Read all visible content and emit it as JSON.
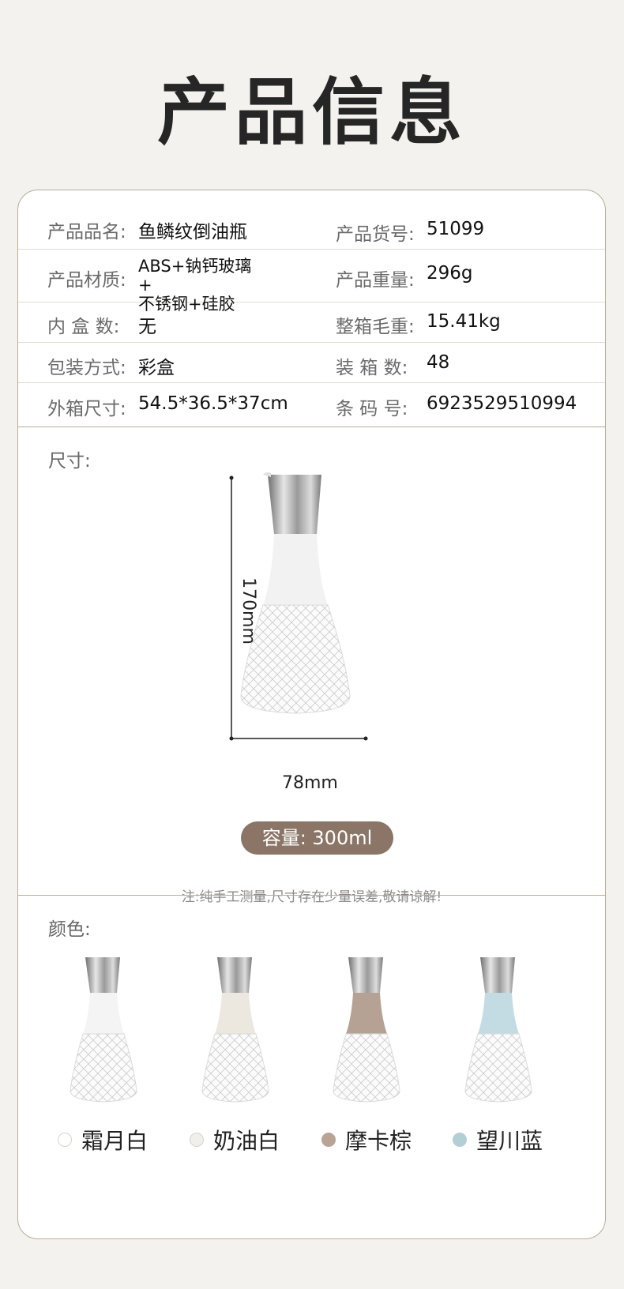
{
  "page_title": "产品信息",
  "specs": [
    {
      "l_label": "产品品名:",
      "l_value": "鱼鳞纹倒油瓶",
      "r_label": "产品货号:",
      "r_value": "51099"
    },
    {
      "l_label": "产品材质:",
      "l_value": "ABS+钠钙玻璃+ 不锈钢+硅胶",
      "r_label": "产品重量:",
      "r_value": "296g"
    },
    {
      "l_label": "内 盒 数:",
      "l_value": "无",
      "r_label": "整箱毛重:",
      "r_value": "15.41kg"
    },
    {
      "l_label": "包装方式:",
      "l_value": "彩盒",
      "r_label": "装 箱 数:",
      "r_value": "48"
    },
    {
      "l_label": "外箱尺寸:",
      "l_value": "54.5*36.5*37cm",
      "r_label": "条 码 号:",
      "r_value": "6923529510994"
    }
  ],
  "size_section": {
    "label": "尺寸:",
    "height_dim": "170mm",
    "width_dim": "78mm",
    "capacity": "容量: 300ml",
    "note": "注:纯手工测量,尺寸存在少量误差,敬请谅解!"
  },
  "color_section": {
    "label": "颜色:",
    "colors": [
      {
        "name": "霜月白",
        "hex": "#ffffff",
        "sleeve": "#f4f4f4"
      },
      {
        "name": "奶油白",
        "hex": "#f0efeb",
        "sleeve": "#ece8df"
      },
      {
        "name": "摩卡棕",
        "hex": "#b9a394",
        "sleeve": "#b6a294"
      },
      {
        "name": "望川蓝",
        "hex": "#b4ced6",
        "sleeve": "#c3dce4"
      }
    ]
  }
}
